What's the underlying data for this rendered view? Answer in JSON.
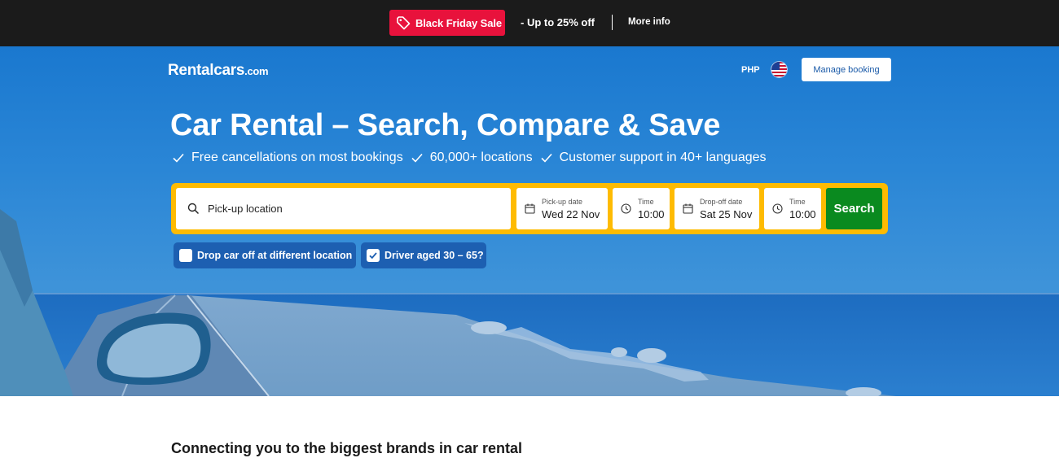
{
  "promo": {
    "badge_label": "Black Friday Sale",
    "text": "- Up to 25% off",
    "link": "More info",
    "badge_color": "#e8123c"
  },
  "header": {
    "logo_main": "Rentalcars",
    "logo_suffix": ".com",
    "currency": "PHP",
    "flag_icon": "us-flag-icon",
    "manage_booking": "Manage booking"
  },
  "hero": {
    "title": "Car Rental – Search, Compare & Save",
    "usps": [
      "Free cancellations on most bookings",
      "60,000+ locations",
      "Customer support in 40+ languages"
    ]
  },
  "search": {
    "location_placeholder": "Pick-up location",
    "pickup_date_label": "Pick-up date",
    "pickup_date_value": "Wed 22 Nov",
    "pickup_time_label": "Time",
    "pickup_time_value": "10:00",
    "dropoff_date_label": "Drop-off date",
    "dropoff_date_value": "Sat 25 Nov",
    "dropoff_time_label": "Time",
    "dropoff_time_value": "10:00",
    "button": "Search",
    "button_color": "#0a8a1f",
    "frame_color": "#febb02"
  },
  "options": {
    "dropoff_different": {
      "label": "Drop car off at different location",
      "checked": false
    },
    "driver_age": {
      "label": "Driver aged 30 – 65?",
      "checked": true
    }
  },
  "brands": {
    "heading": "Connecting you to the biggest brands in car rental"
  }
}
